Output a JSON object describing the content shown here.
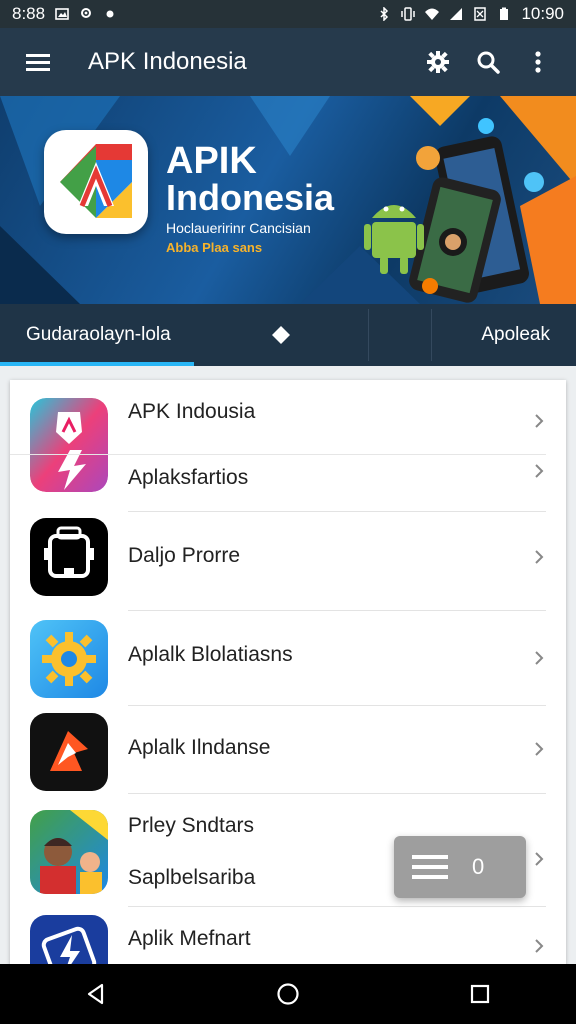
{
  "status_bar": {
    "time_left": "8:88",
    "time_right": "10:90",
    "icons_left": [
      "image-icon",
      "location-icon",
      "dot-icon"
    ],
    "icons_right": [
      "bluetooth-icon",
      "vibrate-icon",
      "wifi-icon",
      "signal-icon",
      "nosim-icon",
      "battery-icon"
    ]
  },
  "app_bar": {
    "menu_icon": "hamburger-menu-icon",
    "title": "APK Indonesia",
    "actions": [
      "settings-gear-icon",
      "search-icon",
      "overflow-menu-icon"
    ]
  },
  "banner": {
    "title_line1": "APIK",
    "title_line2": "Indonesia",
    "subtitle": "Hoclaueririnr Cancisian",
    "tagline": "Abba Plaa sans"
  },
  "tabs": [
    {
      "label": "Gudaraolayn-lola",
      "active": true
    },
    {
      "label": "",
      "icon": "diamond-icon",
      "active": false
    },
    {
      "label": "",
      "active": false
    },
    {
      "label": "Apoleak",
      "active": false
    }
  ],
  "list": {
    "items": [
      {
        "label": "APK Indousia",
        "icon": "app-icon-apk-indousia"
      },
      {
        "label": "Aplaksfartios",
        "icon": "app-icon-aplaksfartios"
      },
      {
        "label": "Daljo Prorre",
        "icon": "app-icon-daljo-prorre"
      },
      {
        "label": "Aplalk Blolatiasns",
        "icon": "app-icon-gear"
      },
      {
        "label": "Aplalk Ilndanse",
        "icon": "app-icon-ilndanse"
      },
      {
        "label": "Prley Sndtars",
        "icon": "app-icon-prley-sndtars"
      },
      {
        "label": "Saplbelsariba",
        "icon": ""
      },
      {
        "label": "Aplik Mefnart",
        "icon": "app-icon-mefnart"
      }
    ]
  },
  "floating_button": {
    "icon": "hamburger-menu-icon",
    "value": "0"
  },
  "nav_bar": {
    "buttons": [
      "back-icon",
      "home-icon",
      "recents-icon"
    ]
  },
  "colors": {
    "status_bar": "#263238",
    "app_bar": "#263a4c",
    "tab_bar": "#1f3447",
    "tab_indicator": "#29b6f6",
    "banner_accent": "#f7b32b"
  }
}
